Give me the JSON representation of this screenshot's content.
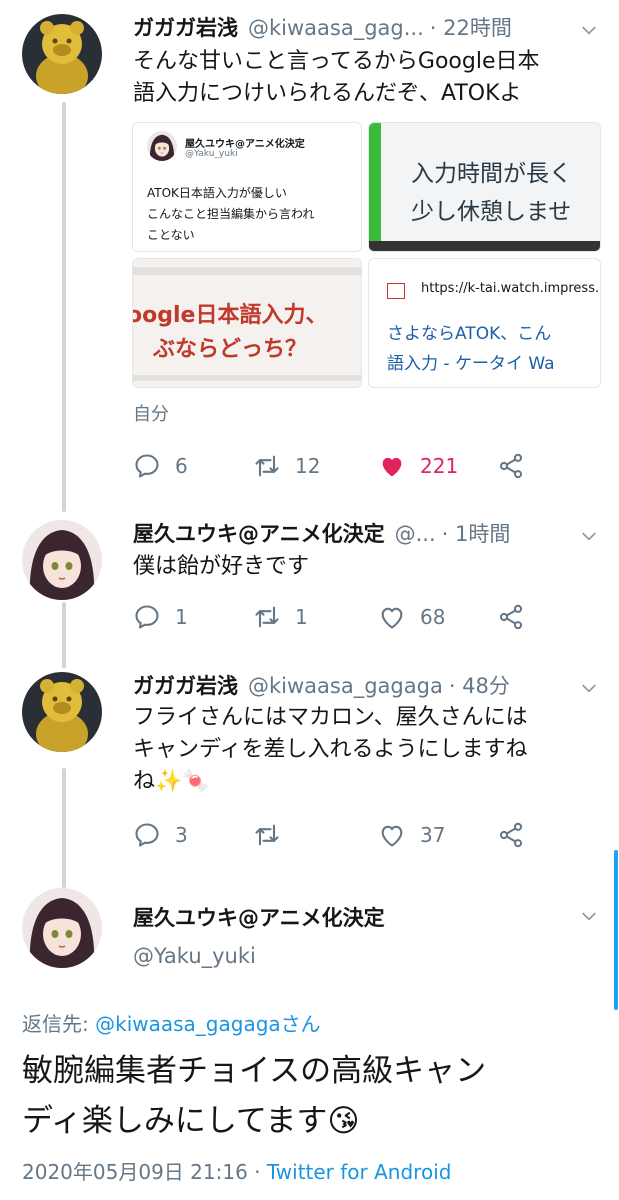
{
  "tweets": [
    {
      "name": "ガガガ岩浅",
      "handle": "@kiwaasa_gag...",
      "time": "· 22時間",
      "text_line1": "そんな甘いこと言ってるからGoogle日本",
      "text_line2": "語入力につけいられるんだぞ、ATOKよ",
      "label": "自分",
      "replies": "6",
      "retweets": "12",
      "likes": "221"
    },
    {
      "name": "屋久ユウキ@アニメ化決定",
      "handle": "@...",
      "time": "· 1時間",
      "text_line1": "僕は飴が好きです",
      "replies": "1",
      "retweets": "1",
      "likes": "68"
    },
    {
      "name": "ガガガ岩浅",
      "handle": "@kiwaasa_gagaga",
      "time": "· 48分",
      "text_line1": "フライさんにはマカロン、屋久さんには",
      "text_line2": "キャンディを差し入れるようにしますね",
      "text_line3": "ね✨🍬",
      "replies": "3",
      "retweets": "",
      "likes": "37"
    }
  ],
  "media": {
    "quote": {
      "name": "屋久ユウキ@アニメ化決定",
      "handle": "@Yaku_yuki",
      "line1": "ATOK日本語入力が優しい",
      "line2": "こんなこと担当編集から言われ",
      "line3": "ことない"
    },
    "screen": {
      "line1": "入力時間が長く",
      "line2": "少し休憩しませ"
    },
    "banner": {
      "line1": "oogle日本語入力、",
      "line2": "ぶならどっち？"
    },
    "link": {
      "url": "https://k-tai.watch.impress.",
      "title1": "さよならATOK、こん",
      "title2": "語入力 - ケータイ Wa"
    }
  },
  "focused": {
    "name": "屋久ユウキ@アニメ化決定",
    "handle": "@Yaku_yuki",
    "reply_prefix": "返信先: ",
    "reply_to": "@kiwaasa_gagagaさん",
    "text_line1": "敏腕編集者チョイスの高級キャン",
    "text_line2": "ディ楽しみにしてます😘",
    "date": "2020年05月09日 21:16",
    "sep": " · ",
    "source": "Twitter for Android"
  },
  "icons": [
    "reply-icon",
    "retweet-icon",
    "like-icon",
    "share-icon",
    "chevron-down-icon"
  ],
  "colors": {
    "like": "#e0245e",
    "link": "#1b95e0",
    "muted": "#657786",
    "thread": "#ccd6dd"
  }
}
